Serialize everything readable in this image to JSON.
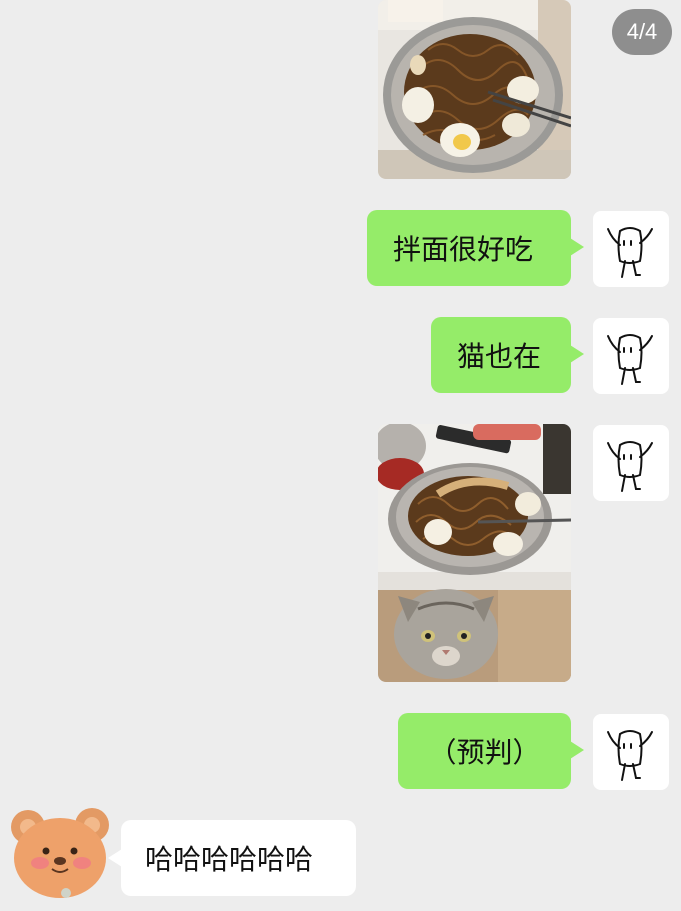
{
  "page_indicator": "4/4",
  "messages": [
    {
      "type": "image",
      "sender": "me",
      "depicts": "noodles in bowl"
    },
    {
      "type": "text",
      "sender": "me",
      "text": "拌面很好吃"
    },
    {
      "type": "text",
      "sender": "me",
      "text": "猫也在"
    },
    {
      "type": "image",
      "sender": "me",
      "depicts": "noodles on table with cat underneath"
    },
    {
      "type": "text",
      "sender": "me",
      "text": "（预判）"
    },
    {
      "type": "text",
      "sender": "other",
      "text": "哈哈哈哈哈哈"
    }
  ],
  "colors": {
    "background": "#ededed",
    "outgoing_bubble": "#95ec69",
    "incoming_bubble": "#ffffff",
    "indicator": "#8e8e8e"
  },
  "icons": {
    "my_avatar": "doodle-figure-avatar-icon",
    "other_avatar": "bear-sticker-avatar-icon"
  }
}
